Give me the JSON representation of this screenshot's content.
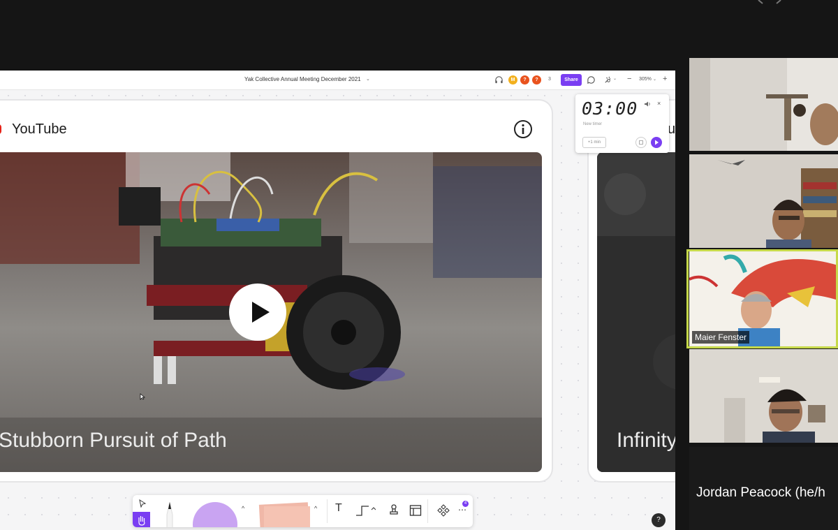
{
  "board": {
    "doc_title": "Yak Collective Annual Meeting December 2021",
    "share_label": "Share",
    "avatars": [
      {
        "initial": "M",
        "color": "#f2b01e"
      },
      {
        "initial": "?",
        "color": "#e9531e"
      },
      {
        "initial": "?",
        "color": "#e9531e"
      }
    ],
    "participant_count": "3",
    "zoom_level": "305%",
    "zoom_minus": "−",
    "zoom_plus": "+",
    "caret": "⌄"
  },
  "video_card": {
    "source_label": "YouTube",
    "title": "Stubborn Pursuit of Path",
    "info_icon": "info-icon",
    "play_icon": "play-icon"
  },
  "video_card_2": {
    "header_partial": "u",
    "title": "Infinity"
  },
  "timer": {
    "display": "03:00",
    "subtitle": "New timer",
    "add_minute_label": "+1 min"
  },
  "toolbar": {
    "tools": [
      "select-tool",
      "hand-tool",
      "pen-tool",
      "shape-tool",
      "sticky-note-tool",
      "text-tool",
      "connector-tool",
      "stamp-tool",
      "frame-tool",
      "components-tool",
      "more-tool"
    ],
    "text_label": "T",
    "badge_count": "4",
    "more_label": "⋯"
  },
  "help_label": "?",
  "participants": [
    {
      "name": "",
      "active": false
    },
    {
      "name": "",
      "active": false
    },
    {
      "name": "Maier Fenster",
      "active": true
    },
    {
      "name": "",
      "active": false
    },
    {
      "name": "Jordan Peacock (he/h",
      "active": false
    }
  ],
  "colors": {
    "accent": "#7a3ef2",
    "active_speaker": "#c6d94a",
    "youtube_red": "#e62117"
  }
}
